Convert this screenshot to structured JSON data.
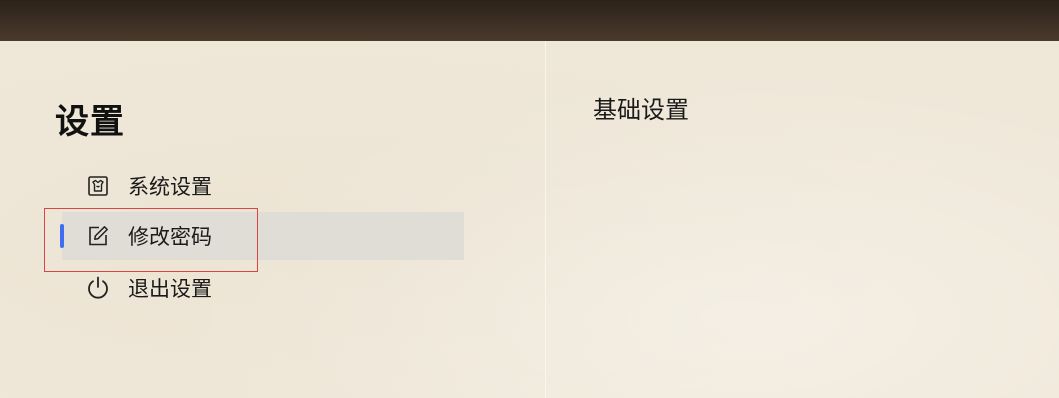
{
  "sidebar": {
    "title": "设置",
    "items": [
      {
        "label": "系统设置",
        "icon": "system-settings-icon",
        "active": false
      },
      {
        "label": "修改密码",
        "icon": "edit-icon",
        "active": true
      },
      {
        "label": "退出设置",
        "icon": "power-icon",
        "active": false
      }
    ]
  },
  "content": {
    "title": "基础设置"
  },
  "colors": {
    "active_indicator": "#3f6df0",
    "highlight_border": "#d94545",
    "active_background": "#e0ddd6",
    "top_bar": "#3d2f24"
  }
}
